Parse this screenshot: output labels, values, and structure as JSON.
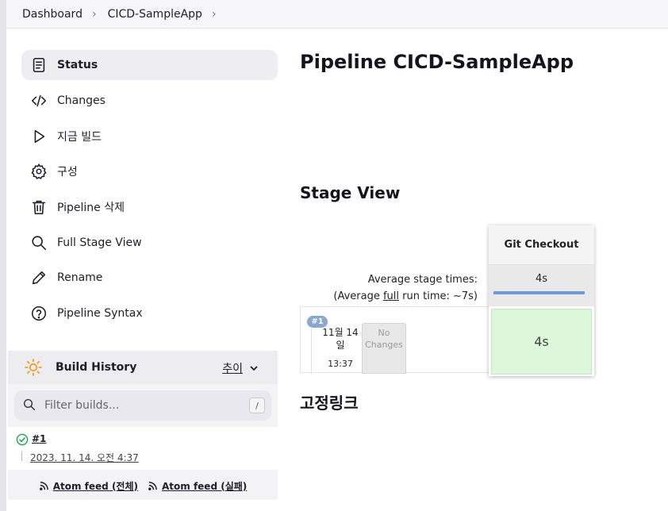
{
  "breadcrumb": {
    "items": [
      "Dashboard",
      "CICD-SampleApp"
    ]
  },
  "sidebar": {
    "items": [
      {
        "label": "Status",
        "icon": "document-icon",
        "active": true
      },
      {
        "label": "Changes",
        "icon": "code-icon"
      },
      {
        "label": "지금 빌드",
        "icon": "play-icon"
      },
      {
        "label": "구성",
        "icon": "gear-icon"
      },
      {
        "label": "Pipeline 삭제",
        "icon": "trash-icon"
      },
      {
        "label": "Full Stage View",
        "icon": "search-icon"
      },
      {
        "label": "Rename",
        "icon": "pencil-icon"
      },
      {
        "label": "Pipeline Syntax",
        "icon": "help-icon"
      }
    ]
  },
  "build_history": {
    "title": "Build History",
    "trend_label": "추이",
    "filter_placeholder": "Filter builds...",
    "filter_shortcut": "/",
    "builds": [
      {
        "number": "#1",
        "date": "2023. 11. 14. 오전 4:37",
        "status": "success"
      }
    ],
    "feeds": {
      "all": "Atom feed (전체)",
      "failed": "Atom feed (실패)"
    }
  },
  "main": {
    "title": "Pipeline CICD-SampleApp",
    "stage_view_title": "Stage View",
    "permalinks_title": "고정링크"
  },
  "stage_view": {
    "avg_label": "Average stage times:",
    "avg_full_prefix": "(Average ",
    "avg_full_link": "full",
    "avg_full_suffix": " run time: ~7s)",
    "stages": [
      {
        "name": "Git Checkout",
        "avg_time": "4s"
      }
    ],
    "runs": [
      {
        "badge": "#1",
        "date_line1": "11월 14",
        "date_line2": "일",
        "time": "13:37",
        "changes": "No Changes",
        "stage_times": [
          "4s"
        ]
      }
    ]
  },
  "colors": {
    "success_cell": "#dcf7da",
    "avg_bar": "#6e98d6",
    "run_badge": "#8aa8cf",
    "success_icon": "#1ea446"
  }
}
